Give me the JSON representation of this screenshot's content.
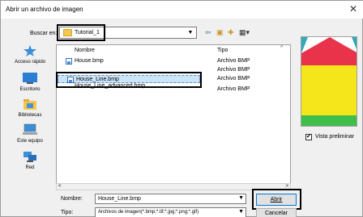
{
  "dialog": {
    "title": "Abrir un archivo de imagen",
    "close_icon": "close-icon"
  },
  "lookin": {
    "label": "Buscar en:",
    "value": "Tutorial_1"
  },
  "toolbar": {
    "back_icon": "back-arrow-icon",
    "up_icon": "up-folder-icon",
    "new_folder_icon": "new-folder-icon",
    "view_icon": "view-menu-icon"
  },
  "places": [
    {
      "label": "Acceso rápido",
      "icon": "star-icon"
    },
    {
      "label": "Escritorio",
      "icon": "desktop-icon"
    },
    {
      "label": "Bibliotecas",
      "icon": "library-icon"
    },
    {
      "label": "Este equipo",
      "icon": "computer-icon"
    },
    {
      "label": "Red",
      "icon": "network-icon"
    }
  ],
  "file_list": {
    "columns": [
      "Nombre",
      "Tipo"
    ],
    "rows": [
      {
        "name": "House.bmp",
        "type": "Archivo BMP",
        "selected": false
      },
      {
        "name": "",
        "type": "Archivo BMP",
        "selected": false
      },
      {
        "name": "House_Line.bmp",
        "type": "Archivo BMP",
        "selected": true
      },
      {
        "name": "House_Line_advanced.bmp",
        "type": "Archivo BMP",
        "selected": false
      }
    ]
  },
  "preview": {
    "label": "Vista preliminar",
    "checked": true,
    "colors": {
      "red": "#e8334a",
      "cyan": "#32a9b8",
      "yellow": "#f5e61c",
      "green": "#3fbf4a"
    }
  },
  "filename": {
    "label": "Nombre:",
    "value": "House_Line.bmp"
  },
  "filetype": {
    "label": "Tipo:",
    "value": "Archivos de imagen(*.bmp;*.tif;*.jpg;*.png;*.gif)"
  },
  "buttons": {
    "open": "Abrir",
    "cancel": "Cancelar"
  }
}
